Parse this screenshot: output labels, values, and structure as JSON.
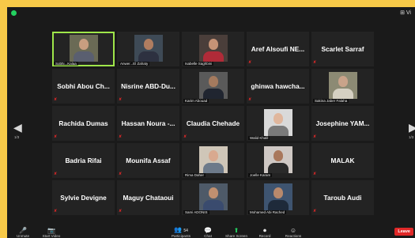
{
  "topbar": {
    "view_label": "⊞ Vi"
  },
  "grid": {
    "tiles": [
      {
        "type": "video",
        "caption": "Sobhi...Kalaa",
        "active": true,
        "colors": {
          "bg": "#6a6a55",
          "skin": "#c89e80",
          "cloth": "#5a5f70"
        }
      },
      {
        "type": "video",
        "caption": "Anwer...El Zahaty",
        "colors": {
          "bg": "#3e4a56",
          "skin": "#b07d60",
          "cloth": "#2d3140"
        }
      },
      {
        "type": "video",
        "caption": "Isabelle Saghbini",
        "colors": {
          "bg": "#4a3e3a",
          "skin": "#c69376",
          "cloth": "#b02b38"
        }
      },
      {
        "type": "name",
        "name": "Aref Alsoufi NE..."
      },
      {
        "type": "name",
        "name": "Scarlet Sarraf"
      },
      {
        "type": "name",
        "name": "Sobhi Abou Ch..."
      },
      {
        "type": "name",
        "name": "Nisrine ABD-Du..."
      },
      {
        "type": "video",
        "caption": "Karim Abouad",
        "colors": {
          "bg": "#5a5a5a",
          "skin": "#a47a5e",
          "cloth": "#202530"
        }
      },
      {
        "type": "name",
        "name": "ghinwa hawcha..."
      },
      {
        "type": "video",
        "caption": "Sakina Jaber Falaha",
        "colors": {
          "bg": "#8c8a74",
          "skin": "#c9a38a",
          "cloth": "#d5d0c2"
        }
      },
      {
        "type": "name",
        "name": "Rachida Dumas"
      },
      {
        "type": "name",
        "name": "Hassan Noura -..."
      },
      {
        "type": "name",
        "name": "Claudia Chehade"
      },
      {
        "type": "video",
        "caption": "Walid Khalil",
        "colors": {
          "bg": "#d9d9d9",
          "skin": "#e0b69c",
          "cloth": "#7a7a7a"
        }
      },
      {
        "type": "name",
        "name": "Josephine YAM..."
      },
      {
        "type": "name",
        "name": "Badria Rifai"
      },
      {
        "type": "name",
        "name": "Mounifa Assaf"
      },
      {
        "type": "video",
        "caption": "Rima Daher",
        "colors": {
          "bg": "#cfc6b8",
          "skin": "#d9a98f",
          "cloth": "#6d7a8a"
        }
      },
      {
        "type": "video",
        "caption": "Joelle Karam",
        "colors": {
          "bg": "#cfc8c4",
          "skin": "#a9775c",
          "cloth": "#2a2a2a"
        }
      },
      {
        "type": "name",
        "name": "MALAK"
      },
      {
        "type": "name",
        "name": "Sylvie Devigne"
      },
      {
        "type": "name",
        "name": "Maguy Chataoui"
      },
      {
        "type": "video",
        "caption": "Sami ADONIS",
        "colors": {
          "bg": "#4e5a68",
          "skin": "#c09070",
          "cloth": "#3a4b6e"
        }
      },
      {
        "type": "video",
        "caption": "Mohamed Abi Rached",
        "colors": {
          "bg": "#3e5470",
          "skin": "#b8896c",
          "cloth": "#1e2a3a"
        }
      },
      {
        "type": "name",
        "name": "Taroub Audi"
      }
    ]
  },
  "nav": {
    "left_arrow": "◀",
    "right_arrow": "▶",
    "left_page": "1/3",
    "right_page": "1/3"
  },
  "toolbar": {
    "unmute": {
      "icon": "🎤",
      "label": "Unmute"
    },
    "video": {
      "icon": "📷",
      "label": "Start Video"
    },
    "participants": {
      "icon": "👥",
      "label": "Participants"
    },
    "participants_count": "54",
    "chat": {
      "icon": "💬",
      "label": "Chat"
    },
    "share": {
      "icon": "⬆",
      "label": "Share Screen"
    },
    "record": {
      "icon": "⏺",
      "label": "Record"
    },
    "reactions": {
      "icon": "☺",
      "label": "Reactions"
    },
    "leave": "Leave"
  },
  "colors": {
    "accent": "#9fe64a",
    "frame": "#f7c948",
    "leave": "#e02828",
    "mic_muted": "#e02828"
  }
}
